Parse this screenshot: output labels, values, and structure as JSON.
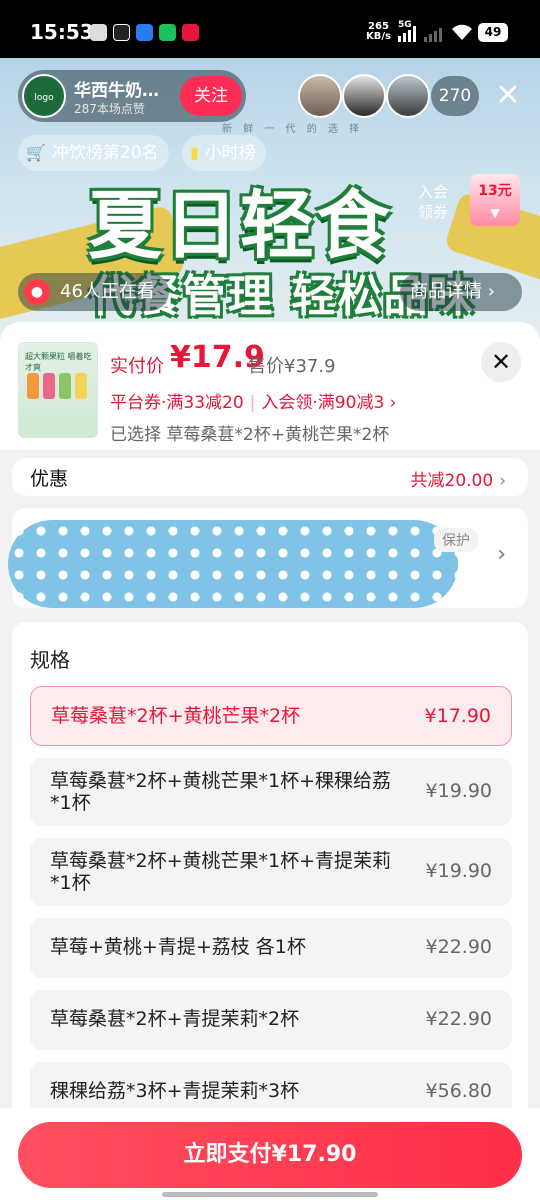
{
  "status_bar": {
    "time": "15:53",
    "net_speed_value": "265",
    "net_speed_unit": "KB/s",
    "network": "5G",
    "battery": "49"
  },
  "live": {
    "shop_name": "华西牛奶…",
    "shop_fans": "287本场点赞",
    "follow_label": "关注",
    "brand_small_text": "新 鲜 一 代 的 选 择",
    "viewer_count": "270",
    "rank_tag": "冲饮榜第20名",
    "hour_tag": "小时榜",
    "banner_headline": "夏日轻食",
    "banner_subline": "代餐管理 轻松品味",
    "coupon_label_1": "入会",
    "coupon_label_2": "领券",
    "coupon_value": "13元",
    "watching_text": "46人正在看",
    "detail_label": "商品详情"
  },
  "product": {
    "thumb_text": "超大颗果粒 嚼着吃才爽",
    "price_label": "实付价",
    "price": "¥17.9",
    "list_price": "售价¥37.9",
    "coupon_platform": "平台券·满33减20",
    "coupon_member": "入会领·满90减3",
    "selected": "已选择  草莓桑葚*2杯+黄桃芒果*2杯"
  },
  "discount": {
    "label": "优惠",
    "value": "共减20.00"
  },
  "service": {
    "tag": "保护"
  },
  "spec": {
    "title": "规格",
    "options": [
      {
        "name": "草莓桑葚*2杯+黄桃芒果*2杯",
        "price": "¥17.90",
        "selected": true
      },
      {
        "name": "草莓桑葚*2杯+黄桃芒果*1杯+稞稞给荔*1杯",
        "price": "¥19.90",
        "selected": false
      },
      {
        "name": "草莓桑葚*2杯+黄桃芒果*1杯+青提茉莉*1杯",
        "price": "¥19.90",
        "selected": false
      },
      {
        "name": "草莓+黄桃+青提+荔枝 各1杯",
        "price": "¥22.90",
        "selected": false
      },
      {
        "name": "草莓桑葚*2杯+青提茉莉*2杯",
        "price": "¥22.90",
        "selected": false
      },
      {
        "name": "稞稞给荔*3杯+青提茉莉*3杯",
        "price": "¥56.80",
        "selected": false
      }
    ]
  },
  "pay": {
    "button_label": "立即支付¥17.90"
  },
  "colors": {
    "accent_red": "#e8173a",
    "pay_button": "#ff2f48",
    "follow_button": "#ff2d55",
    "banner_green": "#1f7f3a"
  }
}
